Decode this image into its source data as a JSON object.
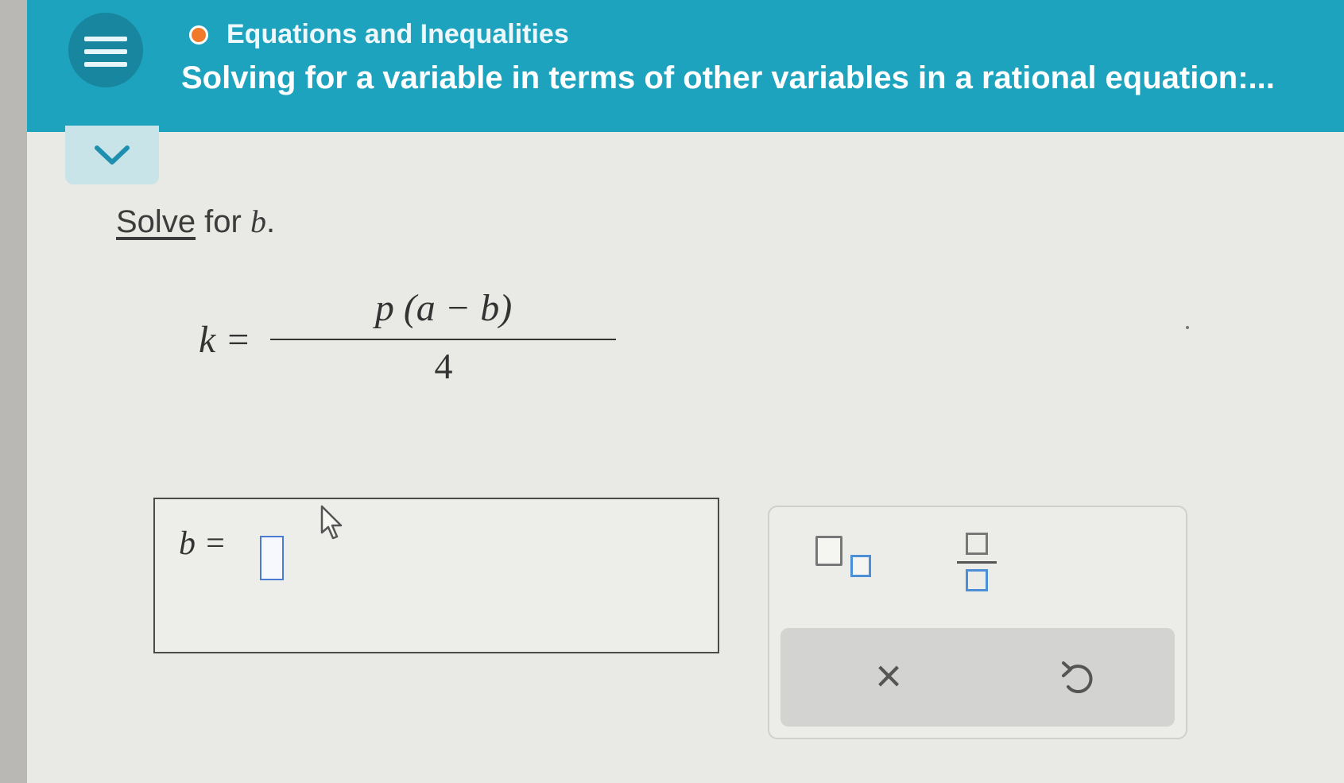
{
  "header": {
    "topic": "Equations and Inequalities",
    "title": "Solving for a variable in terms of other variables in a rational equation:...",
    "status_dot_color": "#f07a2a",
    "background_color": "#1ea3bf"
  },
  "icons": {
    "menu": "hamburger-menu-icon",
    "collapse": "chevron-down-icon",
    "clear": "close-icon",
    "undo": "undo-icon",
    "subscript": "subscript-template-icon",
    "fraction": "fraction-template-icon",
    "cursor": "mouse-pointer-icon"
  },
  "problem": {
    "prompt_link": "Solve",
    "prompt_rest": " for ",
    "variable": "b",
    "period": ".",
    "equation": {
      "lhs": "k =",
      "numerator": "p (a − b)",
      "denominator": "4"
    }
  },
  "answer": {
    "label": "b =",
    "value": ""
  },
  "toolbar": {
    "clear_label": "×"
  }
}
